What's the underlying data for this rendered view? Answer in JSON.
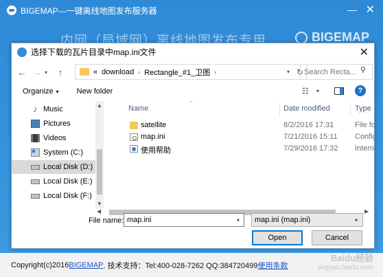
{
  "app": {
    "title": "BIGEMAP—一键离线地图发布服务器",
    "banner": "内网（局域网）离线地图发布专用",
    "brand": "BIGEMAP",
    "footer": {
      "copyright": "Copyright(c)2016 ",
      "brand_link": "BIGEMAP",
      "support": ". 技术支持：Tel:400-028-7262 QQ:384720499 ",
      "terms_link": "使用条款"
    },
    "minimize_glyph": "—",
    "close_glyph": "✕"
  },
  "watermark": {
    "line1": "Baidu经验",
    "line2": "jingyan.baidu.com"
  },
  "dialog": {
    "title": "选择下载的瓦片目录中map.ini文件",
    "close_glyph": "✕",
    "address": {
      "prefix": "«",
      "segments": [
        "download",
        "Rectangle_#1_卫图"
      ],
      "separator": "›"
    },
    "search": {
      "placeholder": "Search Recta..."
    },
    "toolbar": {
      "organize": "Organize",
      "new_folder": "New folder",
      "help": "?"
    },
    "nav_items": [
      {
        "label": "Music",
        "icon": "music-icon"
      },
      {
        "label": "Pictures",
        "icon": "pictures-icon"
      },
      {
        "label": "Videos",
        "icon": "videos-icon"
      },
      {
        "label": "System (C:)",
        "icon": "system-drive-icon"
      },
      {
        "label": "Local Disk (D:)",
        "icon": "disk-icon",
        "selected": true
      },
      {
        "label": "Local Disk (E:)",
        "icon": "disk-icon"
      },
      {
        "label": "Local Disk (F:)",
        "icon": "disk-icon"
      }
    ],
    "columns": {
      "name": "Name",
      "date": "Date modified",
      "type": "Type"
    },
    "files": [
      {
        "name": "satellite",
        "date": "8/2/2016 17:31",
        "type": "File folder",
        "icon": "folder-icon"
      },
      {
        "name": "map.ini",
        "date": "7/21/2016 15:11",
        "type": "Configuration settings",
        "icon": "config-file-icon"
      },
      {
        "name": "使用帮助",
        "date": "7/29/2016 17:32",
        "type": "Internet Shortcut",
        "icon": "internet-shortcut-icon"
      }
    ],
    "file_name_label": "File name:",
    "file_name_value": "map.ini",
    "file_type": "map.ini (map.ini)",
    "open_label": "Open",
    "cancel_label": "Cancel"
  }
}
